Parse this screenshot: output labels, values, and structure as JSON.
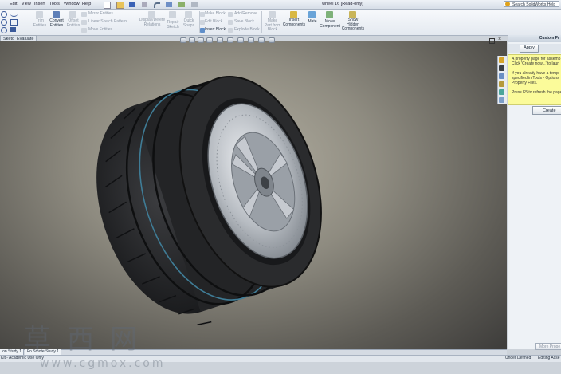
{
  "window": {
    "menus": [
      "Edit",
      "View",
      "Insert",
      "Tools",
      "Window",
      "Help"
    ],
    "title": "wheel 16 [Read-only]",
    "search_placeholder": "Search SolidWorks Help"
  },
  "ribbon": {
    "trim_entities": "Trim\nEntities",
    "convert_entities": "Convert\nEntities",
    "offset_entities": "Offset\nEntities",
    "mirror_entities": "Mirror Entities",
    "linear_sketch_pattern": "Linear Sketch Pattern",
    "move_entities": "Move Entities",
    "display_delete_relations": "Display/Delete\nRelations",
    "repair_sketch": "Repair\nSketch",
    "quick_snaps": "Quick\nSnaps",
    "make_block": "Make Block",
    "edit_block": "Edit Block",
    "insert_block": "Insert Block",
    "add_remove": "Add/Remove",
    "save_block": "Save Block",
    "explode_block": "Explode Block",
    "make_part_from_block": "Make\nPart from\nBlock",
    "insert_components": "Insert\nComponents",
    "mate": "Mate",
    "move_component": "Move\nComponent",
    "show_hidden_components": "Show\nHidden\nComponents"
  },
  "command_tabs": [
    "Sketch",
    "Evaluate"
  ],
  "task_pane": {
    "title": "Custom Pr",
    "apply_label": "Apply",
    "note_lines": [
      "A property page for assemb",
      "Click 'Create now...' to laun",
      "",
      "If you already have a templ",
      "specified in Tools - Options",
      "Property Files.",
      "",
      "Press F5 to refresh the page"
    ],
    "create_label": "Create",
    "more_label": "More Prope"
  },
  "doc_tabs": [
    "ion Study 1",
    "Fo   Smote Study 1"
  ],
  "status": {
    "left": "Kit - Academic Use Only",
    "under_defined": "Under Defined",
    "editing": "Editing Asse"
  },
  "watermark": {
    "chinese": "草西网",
    "url": "www.cgmox.com"
  },
  "colors": {
    "viewport_center": "#b6b2a4",
    "viewport_edge": "#3f3e3c",
    "note_bg": "#fbfb9a",
    "tire": "#2a2b2d",
    "rim": "#c9cdd2"
  }
}
